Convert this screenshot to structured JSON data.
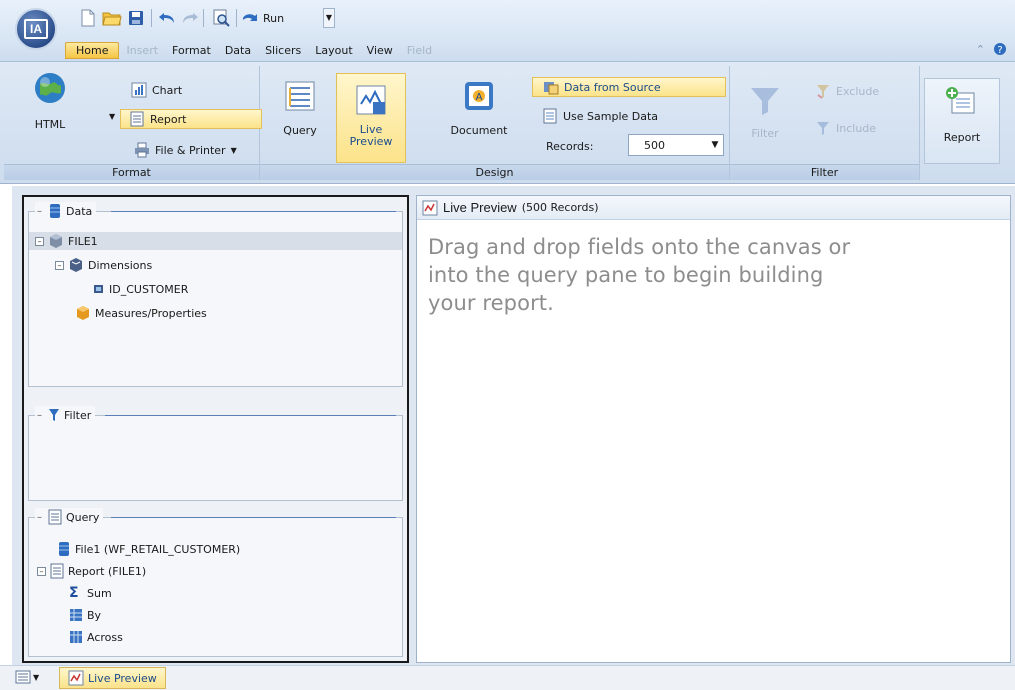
{
  "app": {
    "logo_text": "IA"
  },
  "qat": {
    "run_label": "Run"
  },
  "menu": {
    "tabs": [
      {
        "label": "Home",
        "state": "active"
      },
      {
        "label": "Insert",
        "state": "disabled"
      },
      {
        "label": "Format",
        "state": "normal"
      },
      {
        "label": "Data",
        "state": "normal"
      },
      {
        "label": "Slicers",
        "state": "normal"
      },
      {
        "label": "Layout",
        "state": "normal"
      },
      {
        "label": "View",
        "state": "normal"
      },
      {
        "label": "Field",
        "state": "disabled"
      }
    ]
  },
  "ribbon": {
    "format": {
      "label": "Format",
      "html_label": "HTML",
      "chart_label": "Chart",
      "report_label": "Report",
      "file_printer_label": "File & Printer"
    },
    "design": {
      "label": "Design",
      "query_label": "Query",
      "live_preview_label": "Live Preview",
      "document_label": "Document",
      "data_from_source_label": "Data from Source",
      "use_sample_data_label": "Use Sample Data",
      "records_label": "Records:",
      "records_value": "500"
    },
    "filter": {
      "label": "Filter",
      "filter_label": "Filter",
      "exclude_label": "Exclude",
      "include_label": "Include"
    },
    "report": {
      "report_label": "Report"
    }
  },
  "left": {
    "data": {
      "title": "Data",
      "file_label": "FILE1",
      "dimensions_label": "Dimensions",
      "id_customer_label": "ID_CUSTOMER",
      "measures_label": "Measures/Properties"
    },
    "filter": {
      "title": "Filter"
    },
    "query": {
      "title": "Query",
      "file_label": "File1 (WF_RETAIL_CUSTOMER)",
      "report_label": "Report (FILE1)",
      "sum_label": "Sum",
      "by_label": "By",
      "across_label": "Across"
    }
  },
  "preview": {
    "title": "Live Preview",
    "count": "(500 Records)",
    "hint": "Drag and drop fields onto the canvas or into the query pane to begin building your report."
  },
  "bottom": {
    "tab_label": "Live Preview"
  }
}
